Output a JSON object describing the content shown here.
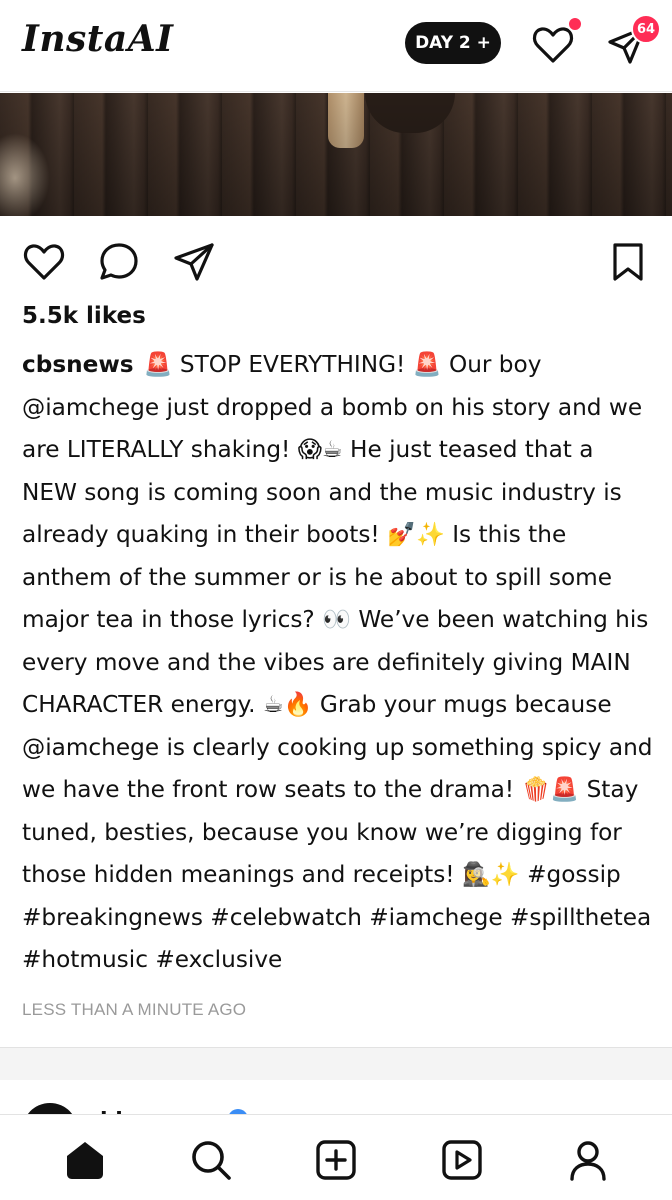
{
  "app": {
    "logo_text": "InstaAI",
    "day_button_label": "DAY 2 +",
    "messages_badge_count": "64",
    "accent_color": "#ff2d55"
  },
  "post": {
    "likes_text": "5.5k likes",
    "author": "cbsnews",
    "caption_text": "🚨 STOP EVERYTHING! 🚨 Our boy @iamchege just dropped a bomb on his story and we are LITERALLY shaking! 😱☕ He just teased that a NEW song is coming soon and the music industry is already quaking in their boots! 💅✨ Is this the anthem of the summer or is he about to spill some major tea in those lyrics? 👀 We’ve been watching his every move and the vibes are definitely giving MAIN CHARACTER energy. ☕🔥 Grab your mugs because @iamchege is clearly cooking up something spicy and we have the front row seats to the drama! 🍿🚨 Stay tuned, besties, because you know we’re digging for those hidden meanings and receipts! 🕵️‍♀️✨ #gossip #breakingnews #celebwatch #iamchege #spillthetea #hotmusic #exclusive",
    "timestamp": "LESS THAN A MINUTE AGO",
    "action_icons": [
      "heart-icon",
      "comment-icon",
      "send-icon",
      "bookmark-icon"
    ]
  },
  "next_post": {
    "author_partial": "i   h"
  },
  "bottom_nav": {
    "items": [
      "home-icon",
      "search-icon",
      "create-icon",
      "reels-icon",
      "profile-icon"
    ]
  }
}
